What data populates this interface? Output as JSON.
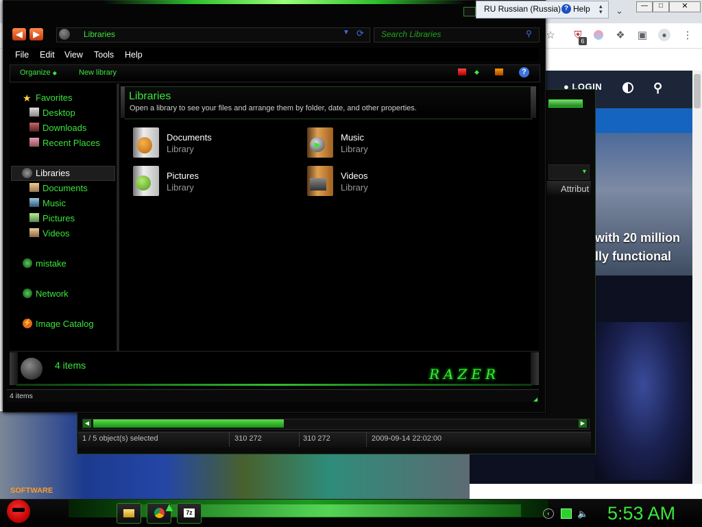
{
  "browser": {
    "login_label": "LOGIN",
    "hero_text": [
      "with 20 million",
      "lly functional"
    ],
    "extension_badge": "6",
    "icons": [
      "star-icon",
      "shield-icon",
      "blur-icon",
      "puzzle-icon",
      "sidebar-icon",
      "profile-icon",
      "menu-dots-icon",
      "contrast-icon",
      "search-icon"
    ]
  },
  "language_bar": {
    "language": "RU Russian (Russia)",
    "help": "Help",
    "help_icon_glyph": "?"
  },
  "explorer": {
    "nav": {
      "back": "◀",
      "forward": "▶"
    },
    "address": "Libraries",
    "search_placeholder": "Search Libraries",
    "menu": [
      "File",
      "Edit",
      "View",
      "Tools",
      "Help"
    ],
    "commands": {
      "organize": "Organize",
      "new_library": "New library",
      "help_glyph": "?"
    },
    "sidebar": {
      "favorites": "Favorites",
      "favorites_items": [
        "Desktop",
        "Downloads",
        "Recent Places"
      ],
      "libraries": "Libraries",
      "libraries_items": [
        "Documents",
        "Music",
        "Pictures",
        "Videos"
      ],
      "homegroup": "mistake",
      "network": "Network",
      "catalog": "Image Catalog"
    },
    "header": {
      "title": "Libraries",
      "subtitle": "Open a library to see your files and arrange them by folder, date, and other properties."
    },
    "libraries": [
      {
        "name": "Documents",
        "type": "Library"
      },
      {
        "name": "Music",
        "type": "Library"
      },
      {
        "name": "Pictures",
        "type": "Library"
      },
      {
        "name": "Videos",
        "type": "Library"
      }
    ],
    "details": {
      "count": "4 items",
      "brand": "RAZER"
    },
    "status": "4 items"
  },
  "sevenzip": {
    "column_attr": "Attribut",
    "status": {
      "selection": "1 / 5 object(s) selected",
      "size": "310 272",
      "packed": "310 272",
      "modified": "2009-09-14 22:02:00"
    }
  },
  "desktop": {
    "software_label": "SOFTWARE"
  },
  "taskbar": {
    "clock": "5:53 AM",
    "zip_label": "7z"
  }
}
